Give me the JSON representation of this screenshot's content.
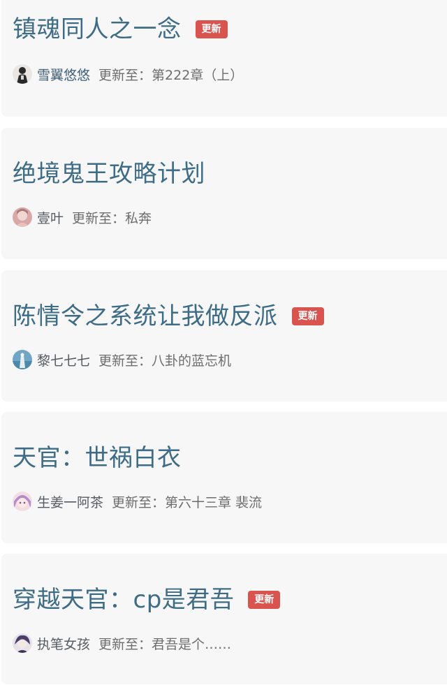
{
  "novels": [
    {
      "title": "镇魂同人之一念",
      "badge": "更新",
      "author": "雪翼悠悠",
      "update": "更新至：第222章（上）",
      "avatar_icon": "dark-figure-avatar",
      "avatar_colors": [
        "#2a2a2a",
        "#d8d4d0"
      ]
    },
    {
      "title": "绝境鬼王攻略计划",
      "badge": "",
      "author": "壹叶",
      "update": "更新至：私奔",
      "avatar_icon": "pink-portrait-avatar",
      "avatar_colors": [
        "#d9a8a8",
        "#f1d7d2"
      ]
    },
    {
      "title": "陈情令之系统让我做反派",
      "badge": "更新",
      "author": "黎七七七",
      "update": "更新至：八卦的蓝忘机",
      "avatar_icon": "blue-scene-avatar",
      "avatar_colors": [
        "#6fa6c8",
        "#e6eef0"
      ]
    },
    {
      "title": "天官：世祸白衣",
      "badge": "",
      "author": "生姜一阿茶",
      "update": "更新至：第六十三章 裴流",
      "avatar_icon": "anime-girl-avatar",
      "avatar_colors": [
        "#b58bc8",
        "#f3dde4"
      ]
    },
    {
      "title": "穿越天官：cp是君吾",
      "badge": "更新",
      "author": "执笔女孩",
      "update": "更新至：君吾是个……",
      "avatar_icon": "anime-boy-avatar",
      "avatar_colors": [
        "#4a3f6b",
        "#e7e2ea"
      ]
    }
  ]
}
